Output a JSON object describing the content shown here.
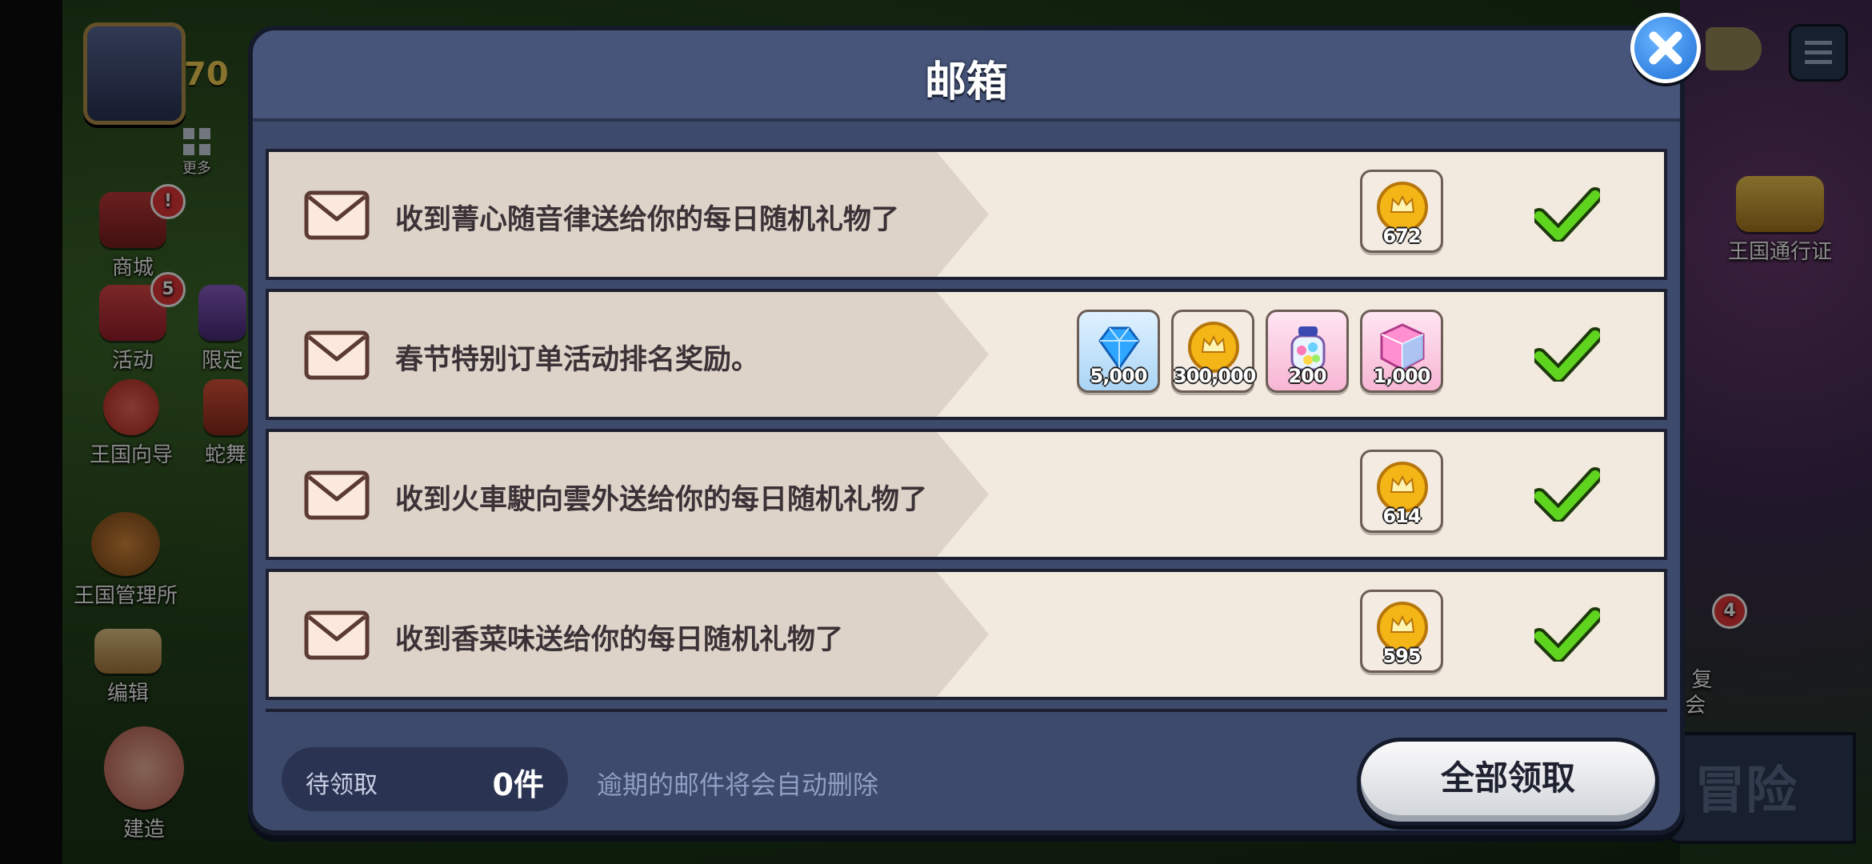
{
  "modal": {
    "title": "邮箱",
    "close_icon": "close-icon",
    "mails": [
      {
        "icon": "envelope-icon",
        "text": "收到菁心随音律送给你的每日随机礼物了",
        "rewards": [
          {
            "icon": "coin-icon",
            "amount": "672"
          }
        ],
        "claim_icon": "checkmark-icon"
      },
      {
        "icon": "envelope-icon",
        "text": "春节特别订单活动排名奖励。",
        "rewards": [
          {
            "icon": "crystal-icon",
            "amount": "5,000"
          },
          {
            "icon": "coin-icon",
            "amount": "300,000"
          },
          {
            "icon": "candy-jar-icon",
            "amount": "200"
          },
          {
            "icon": "rainbow-cube-icon",
            "amount": "1,000"
          }
        ],
        "claim_icon": "checkmark-icon"
      },
      {
        "icon": "envelope-icon",
        "text": "收到火車駛向雲外送给你的每日随机礼物了",
        "rewards": [
          {
            "icon": "coin-icon",
            "amount": "614"
          }
        ],
        "claim_icon": "checkmark-icon"
      },
      {
        "icon": "envelope-icon",
        "text": "收到香菜味送给你的每日随机礼物了",
        "rewards": [
          {
            "icon": "coin-icon",
            "amount": "595"
          }
        ],
        "claim_icon": "checkmark-icon"
      }
    ],
    "footer": {
      "pending_label": "待领取",
      "pending_count": "0件",
      "expire_note": "逾期的邮件将会自动删除",
      "claim_all_label": "全部领取"
    }
  },
  "background": {
    "level": "70",
    "left_menu": [
      {
        "label": "更多",
        "icon": "grid-icon"
      },
      {
        "label": "商城",
        "icon": "shop-icon",
        "badge": "!"
      },
      {
        "label": "活动",
        "icon": "gift-icon",
        "badge": "5"
      },
      {
        "label": "限定",
        "icon": "mystery-icon"
      },
      {
        "label": "王国向导",
        "icon": "compass-icon"
      },
      {
        "label": "蛇舞",
        "icon": "card-icon"
      },
      {
        "label": "王国管理所",
        "icon": "cookie-icon"
      },
      {
        "label": "编辑",
        "icon": "edit-icon"
      },
      {
        "label": "建造",
        "icon": "build-icon"
      }
    ],
    "right_menu": [
      {
        "label": "王国通行证",
        "icon": "pass-icon"
      },
      {
        "label": "复\n会",
        "icon": "guild-icon",
        "badge": "4"
      }
    ],
    "adventure_label": "冒险"
  },
  "colors": {
    "modal_bg": "#3d4a6b",
    "row_bg": "#f2e9df",
    "claim_green": "#5ed41f",
    "close_blue": "#1f6fd6"
  }
}
